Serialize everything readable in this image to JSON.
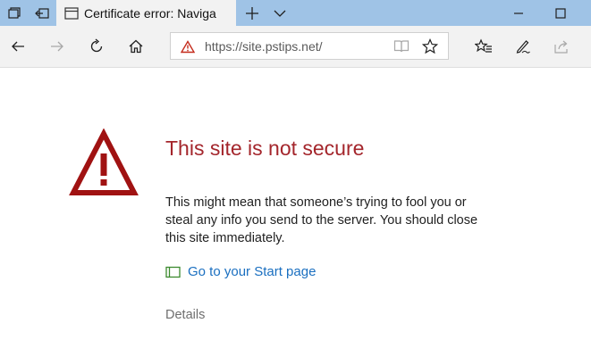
{
  "tabs": {
    "active_title": "Certificate error: Naviga"
  },
  "addressbar": {
    "url": "https://site.pstips.net/"
  },
  "page": {
    "headline": "This site is not secure",
    "message": "This might mean that someone’s trying to fool you or steal any info you send to the server. You should close this site immediately.",
    "start_link": "Go to your Start page",
    "details": "Details"
  },
  "colors": {
    "tabstrip": "#9fc3e6",
    "toolbar": "#f2f2f2",
    "headline": "#a4262c",
    "warning": "#a01212",
    "link": "#1a6fc0"
  },
  "icons": {
    "tab_preview": "tab-preview-icon",
    "set_aside": "set-tabs-aside-icon",
    "new_tab": "plus-icon",
    "tab_list": "chevron-down-icon",
    "back": "back-arrow-icon",
    "forward": "forward-arrow-icon",
    "refresh": "refresh-icon",
    "home": "home-icon",
    "reading_view": "book-icon",
    "favorite": "star-icon",
    "favorites_hub": "favorites-hub-icon",
    "notes": "pen-icon",
    "share": "share-icon",
    "minimize": "minimize-icon",
    "maximize": "maximize-icon"
  }
}
